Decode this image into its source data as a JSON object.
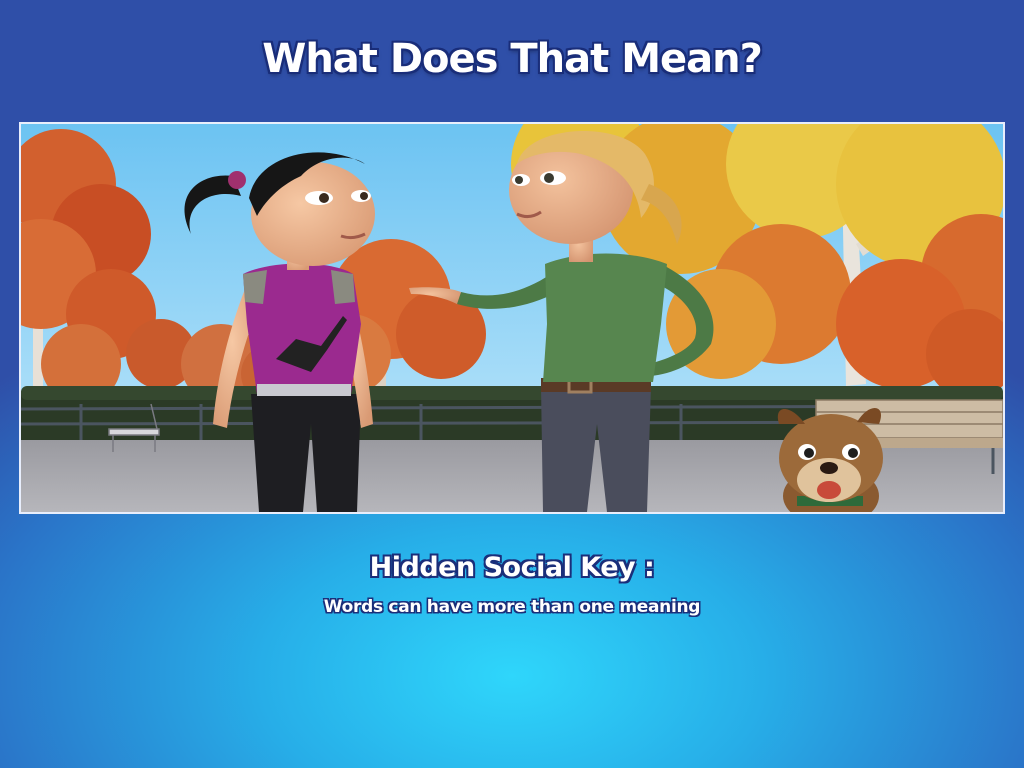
{
  "page": {
    "title": "What Does That Mean?",
    "key_heading": "Hidden Social Key :",
    "key_text": "Words can have more than one meaning"
  },
  "scene": {
    "setting": "autumn park",
    "characters": [
      "girl-dark-hair",
      "girl-blonde-hair",
      "brown-puppy"
    ]
  },
  "colors": {
    "background_top": "#2f4fa8",
    "background_glow": "#2fd6fb",
    "title_text": "#ffffff",
    "text_outline": "#1a2e7a"
  }
}
